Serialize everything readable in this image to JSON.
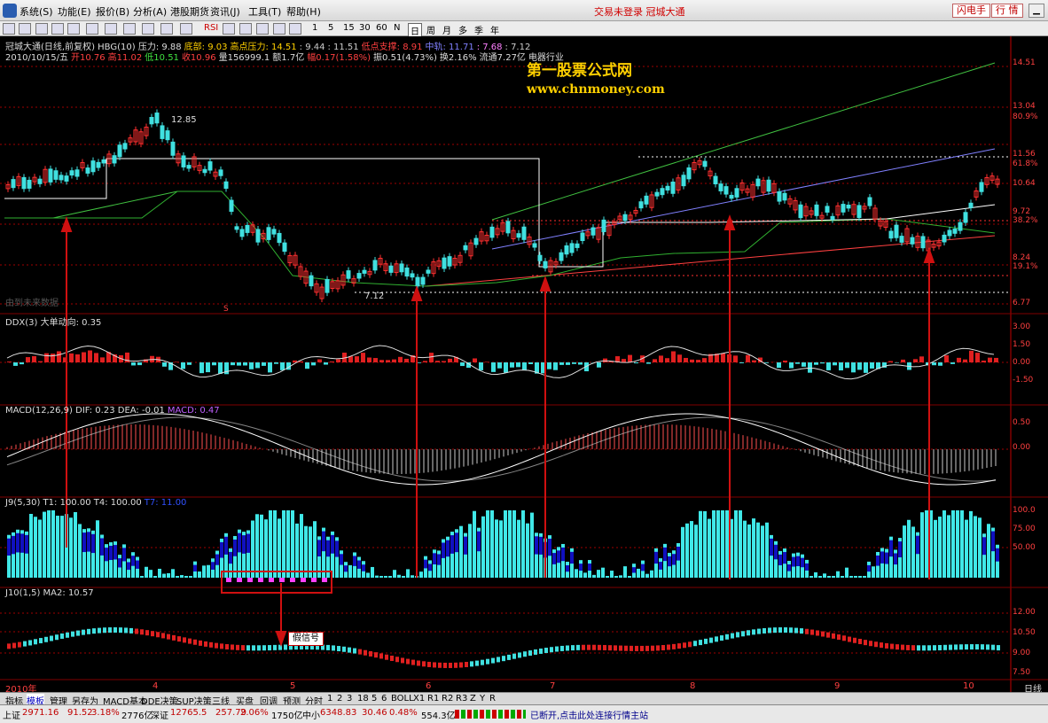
{
  "menubar": {
    "items": [
      "系统(S)",
      "功能(E)",
      "报价(B)",
      "分析(A)",
      "港股期货",
      "资讯(J)",
      "工具(T)",
      "帮助(H)"
    ],
    "title": "交易未登录  冠城大通",
    "buttons": [
      "闪电手",
      "行  情"
    ]
  },
  "toolbar": {
    "periods": [
      "1",
      "5",
      "15",
      "30",
      "60",
      "N",
      "日",
      "周",
      "月",
      "多",
      "季",
      "年"
    ],
    "active_period": "日",
    "rsi_label": "RSI"
  },
  "main_panel": {
    "line1": [
      "冠城大通(日线,前复权) HBG(10) 压力: 9.88",
      "底部: 9.03",
      "高点压力: 14.51",
      ": 9.44",
      ": 11.51",
      "低点支撑: 8.91",
      "中轨: 11.71",
      ": 7.68",
      ": 7.12"
    ],
    "line2": [
      "2010/10/15/五",
      "开10.76",
      "高11.02",
      "低10.51",
      "收10.96",
      "量156999.1",
      "额1.7亿",
      "幅0.17(1.58%)",
      "振0.51(4.73%)",
      "换2.16%",
      "流通7.27亿",
      "电器行业"
    ],
    "watermark_line1": "第一股票公式网",
    "watermark_line2": "www.chnmoney.com",
    "label_high": "12.85",
    "label_low": "7.12",
    "faint_note": "由到未来数据",
    "y_labels": [
      "14.51",
      "13.04",
      "80.9%",
      "11.56",
      "61.8%",
      "10.64",
      "9.72",
      "38.2%",
      "8.24",
      "19.1%",
      "6.77"
    ],
    "flag_label": "S"
  },
  "ddx_panel": {
    "title": "DDX(3) 大单动向: 0.35",
    "y_labels": [
      "3.00",
      "1.50",
      "0.00",
      "-1.50"
    ]
  },
  "macd_panel": {
    "title_prefix": "MACD(12,26,9) DIF: 0.23 DEA: -0.01",
    "title_macd": "MACD: 0.47",
    "y_labels": [
      "0.50",
      "0.00"
    ]
  },
  "j9_panel": {
    "title": "J9(5,30) T1: 100.00 T4: 100.00",
    "title_tail": "T7: 11.00",
    "y_labels": [
      "100.0",
      "75.00",
      "50.00"
    ]
  },
  "j10_panel": {
    "title": "J10(1,5) MA2: 10.57",
    "y_labels": [
      "12.00",
      "10.50",
      "9.00",
      "7.50"
    ],
    "note": "假信号"
  },
  "x_axis": {
    "labels": [
      "2010年",
      "4",
      "5",
      "6",
      "7",
      "8",
      "9",
      "10"
    ],
    "right_label": "日线"
  },
  "tabs": {
    "items": [
      "指标",
      "模板",
      "管理",
      "另存为",
      "MACD基本",
      "DDE决策",
      "SUP决策",
      "三线",
      "买盘",
      "回调",
      "预测",
      "分时",
      "1",
      "2",
      "3",
      "18",
      "5",
      "6",
      "BOLL",
      "X1",
      "R1",
      "R2",
      "R3",
      "Z",
      "Y",
      "R"
    ],
    "active": "模板"
  },
  "statusbar": {
    "sh_label": "上证",
    "sh_value": "2971.16",
    "sh_change": "91.52",
    "sh_pct": "3.18%",
    "sh_amount": "2776亿",
    "sz_label": "深证",
    "sz_value": "12765.5",
    "sz_change": "257.79",
    "sz_pct": "2.06%",
    "sz_amount": "1750亿",
    "zx_label": "中小",
    "zx_value": "6348.83",
    "zx_change": "30.46",
    "zx_pct": "0.48%",
    "zx_amount": "554.3亿",
    "message": "已断开,点击此处连接行情主站"
  },
  "colors": {
    "up": "#ff3030",
    "down": "#40e0e0",
    "accent": "#ffd000",
    "signal": "#d01010"
  }
}
